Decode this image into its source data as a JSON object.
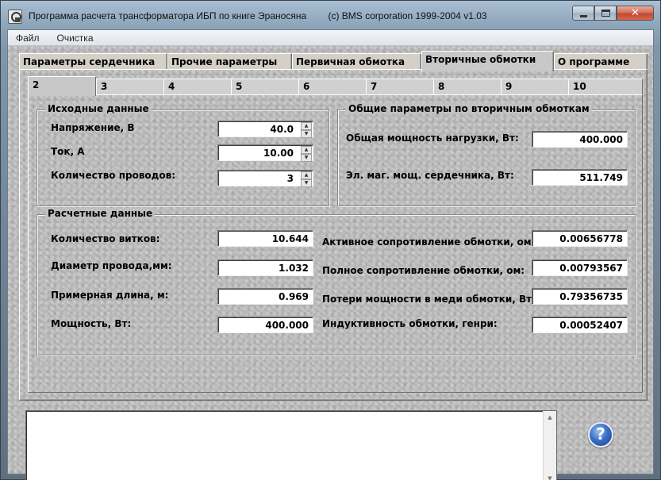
{
  "window": {
    "title": "Программа расчета трансформатора ИБП по книге Эраносяна",
    "copyright": "(c) BMS corporation 1999-2004  v1.03",
    "buttons": {
      "minimize": "",
      "maximize": "",
      "close": "✕"
    }
  },
  "menu": [
    "Файл",
    "Очистка"
  ],
  "tabs": [
    {
      "label": "Параметры сердечника",
      "active": false
    },
    {
      "label": "Прочие параметры",
      "active": false
    },
    {
      "label": "Первичная обмотка",
      "active": false
    },
    {
      "label": "Вторичные обмотки",
      "active": true
    },
    {
      "label": "О программе",
      "active": false
    }
  ],
  "subtabs": [
    "2",
    "3",
    "4",
    "5",
    "6",
    "7",
    "8",
    "9",
    "10"
  ],
  "input_group": {
    "title": "Исходные данные",
    "voltage": {
      "label": "Напряжение, В",
      "value": "40.0"
    },
    "current": {
      "label": "Ток, А",
      "value": "10.00"
    },
    "wires": {
      "label": "Количество проводов:",
      "value": "3"
    }
  },
  "general_group": {
    "title": "Общие параметры по вторичным обмоткам",
    "load_power": {
      "label": "Общая мощность нагрузки, Вт:",
      "value": "400.000"
    },
    "core_power": {
      "label": "Эл. маг. мощ. сердечника, Вт:",
      "value": "511.749"
    }
  },
  "calc_group": {
    "title": "Расчетные данные",
    "turns": {
      "label": "Количество витков:",
      "value": "10.644"
    },
    "wire_diameter": {
      "label": "Диаметр провода,мм:",
      "value": "1.032"
    },
    "length": {
      "label": "Примерная длина, м:",
      "value": "0.969"
    },
    "power": {
      "label": "Мощность, Вт:",
      "value": "400.000"
    },
    "active_resistance": {
      "label": "Активное сопротивление обмотки, ом:",
      "value": "0.00656778"
    },
    "full_resistance": {
      "label": "Полное сопротивление обмотки, ом:",
      "value": "0.00793567"
    },
    "copper_loss": {
      "label": "Потери мощности в меди обмотки, Вт:",
      "value": "0.79356735"
    },
    "inductance": {
      "label": "Индуктивность обмотки, генри:",
      "value": "0.00052407"
    }
  },
  "memo": {
    "value": ""
  },
  "help": {
    "label": "?"
  },
  "icons": {
    "app": "app-icon",
    "spin_up": "▲",
    "spin_down": "▼",
    "scroll_up": "▲",
    "scroll_down": "▼"
  }
}
